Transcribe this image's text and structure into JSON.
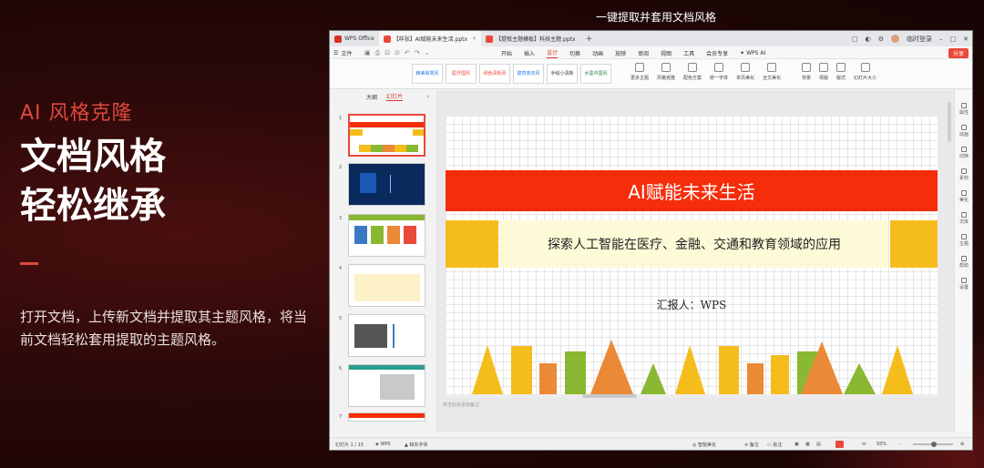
{
  "intro": {
    "subtitle": "AI 风格克隆",
    "heading_line1": "文档风格",
    "heading_line2": "轻松继承",
    "description": "打开文档，上传新文档并提取其主题风格，将当前文档轻松套用提取的主题风格。",
    "accent_color": "#e0483e"
  },
  "caption": "一键提取并套用文档风格",
  "tabs": [
    {
      "label": "WPS Office",
      "icon": "wps-logo-icon",
      "color": "#d93025"
    },
    {
      "label": "【样张】AI赋能未来生活.pptx",
      "icon": "ppt-file-icon",
      "color": "#e9493a",
      "active": true
    },
    {
      "label": "【提取主题模板】科技主题.pptx",
      "icon": "ppt-file-icon",
      "color": "#e9493a"
    }
  ],
  "window_controls": {
    "login": "临时登录"
  },
  "menu": {
    "file": "文件",
    "items": [
      "开始",
      "插入",
      "设计",
      "切换",
      "动画",
      "放映",
      "审阅",
      "视图",
      "工具",
      "会员专享"
    ],
    "active": "设计",
    "ai": "WPS AI",
    "share": "分享"
  },
  "ribbon": {
    "theme_thumbs": [
      "精美极简风",
      "医疗国风",
      "绿色清新风",
      "建筑商务风",
      "手绘小清新",
      "水墨中国风"
    ],
    "tools": [
      "更多主题",
      "风格克隆",
      "配色方案",
      "统一字体",
      "单页美化",
      "全文美化",
      "背景",
      "母版",
      "版式",
      "幻灯片大小"
    ]
  },
  "panel": {
    "tab_outline": "大纲",
    "tab_slides": "幻灯片",
    "slide_numbers": [
      "1",
      "2",
      "3",
      "4",
      "5",
      "6",
      "7"
    ],
    "add_label": "+"
  },
  "slide": {
    "title": "AI赋能未来生活",
    "subtitle": "探索人工智能在医疗、金融、交通和教育领域的应用",
    "reporter": "汇报人：WPS",
    "colors": {
      "red": "#f52d0b",
      "yellow": "#f5bd1c",
      "green": "#8ab832",
      "orange": "#ea8a36"
    }
  },
  "notes_placeholder": "单击此处添加备注",
  "right_bar": [
    "属性",
    "动画",
    "切换",
    "素材",
    "美化",
    "文库",
    "主题",
    "帮助",
    "设置"
  ],
  "status": {
    "slide_count": "幻灯片 1 / 15",
    "app": "WPS",
    "font": "缺失字体",
    "smart_beautify": "智能美化",
    "notes": "备注",
    "comments": "批注",
    "zoom": "93%"
  }
}
